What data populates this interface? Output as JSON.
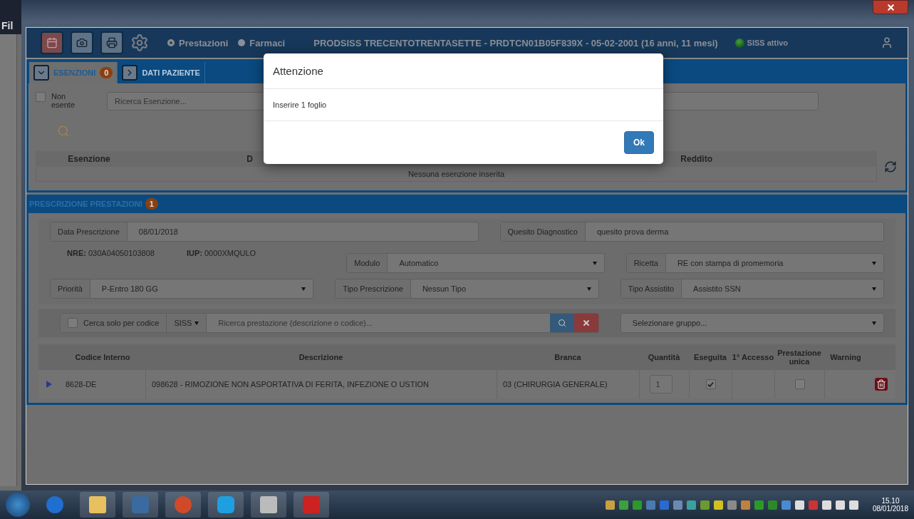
{
  "back_window": {
    "menu_fragment": "Fil"
  },
  "header": {
    "modes": [
      {
        "label": "Prestazioni",
        "selected": true
      },
      {
        "label": "Farmaci",
        "selected": false
      }
    ],
    "patient": "PRODSISS TRECENTOTRENTASETTE - PRDTCN01B05F839X - 05-02-2001 (16 anni, 11 mesi)",
    "siss_status": "SISS attivo"
  },
  "tabs": [
    {
      "label": "ESENZIONI",
      "badge": "0",
      "expanded": true
    },
    {
      "label": "DATI PAZIENTE",
      "expanded": false
    }
  ],
  "esenzioni": {
    "non_esente": {
      "label": "Non esente",
      "checked": false
    },
    "search": {
      "placeholder": "Ricerca Esenzione..."
    },
    "columns": [
      "Esenzione",
      "D",
      "Reddito"
    ],
    "empty_message": "Nessuna esenzione inserita"
  },
  "prescrizione": {
    "title": "PRESCRIZIONE PRESTAZIONI",
    "badge": "1",
    "data_prescrizione": {
      "label": "Data Prescrizione",
      "value": "08/01/2018"
    },
    "quesito": {
      "label": "Quesito Diagnostico",
      "value": "quesito prova derma"
    },
    "nre": {
      "label": "NRE:",
      "value": "030A04050103808"
    },
    "iup": {
      "label": "IUP:",
      "value": "0000XMQULO"
    },
    "modulo": {
      "label": "Modulo",
      "value": "Automatico"
    },
    "ricetta": {
      "label": "Ricetta",
      "value": "RE con stampa di promemoria"
    },
    "priorita": {
      "label": "Priorità",
      "value": "P-Entro 180 GG"
    },
    "tipo_prescrizione": {
      "label": "Tipo Prescrizione",
      "value": "Nessun Tipo"
    },
    "tipo_assistito": {
      "label": "Tipo Assistito",
      "value": "Assistito SSN"
    },
    "search": {
      "code_only": {
        "label": "Cerca solo per codice",
        "checked": false
      },
      "source": "SISS",
      "placeholder": "Ricerca prestazione (descrizione o codice)...",
      "group_placeholder": "Selezionare gruppo..."
    },
    "columns": [
      "Codice Interno",
      "Descrizione",
      "Branca",
      "Quantità",
      "Eseguita",
      "1° Accesso",
      "Prestazione unica",
      "Warning"
    ],
    "rows": [
      {
        "codice": "8628-DE",
        "descrizione": "098628 - RIMOZIONE NON ASPORTATIVA DI FERITA, INFEZIONE O USTION",
        "branca": "03 (CHIRURGIA GENERALE)",
        "quantita": "1",
        "eseguita": true,
        "primo_accesso": false,
        "prestazione_unica": false
      }
    ]
  },
  "dialog": {
    "title": "Attenzione",
    "message": "Inserire 1 foglio",
    "button": "Ok"
  },
  "taskbar": {
    "time": "15.10",
    "date": "08/01/2018"
  }
}
